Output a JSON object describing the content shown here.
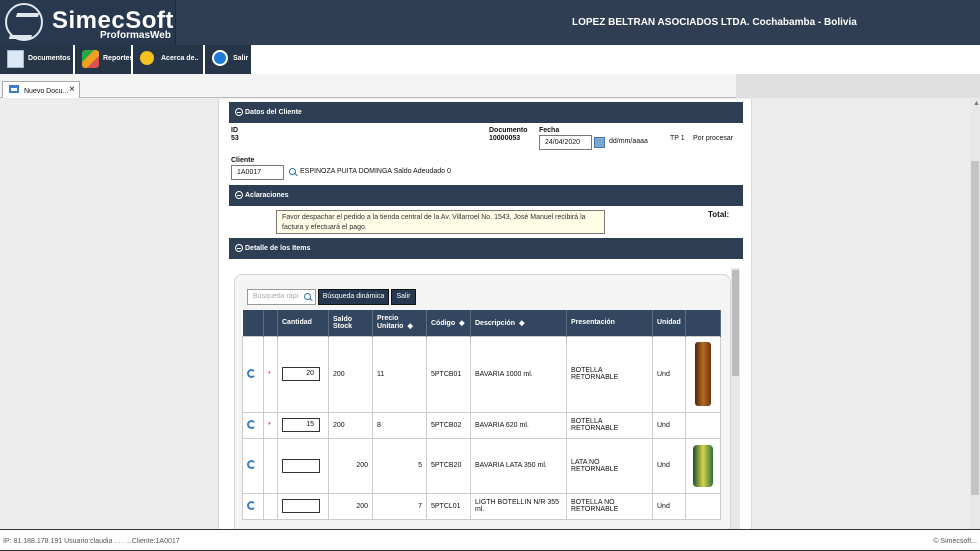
{
  "header": {
    "brand": "SimecSoft",
    "app": "ProformasWeb",
    "company": "LOPEZ BELTRAN ASOCIADOS LTDA. Cochabamba - Bolivia"
  },
  "menu": [
    {
      "label": "Documentos",
      "icon": "document-add-icon"
    },
    {
      "label": "Reportes",
      "icon": "reports-icon"
    },
    {
      "label": "Acerca de..",
      "icon": "award-icon"
    },
    {
      "label": "Salir",
      "icon": "exit-arrow-icon"
    }
  ],
  "tab": {
    "label": "Nuevo Docu...",
    "close": "×"
  },
  "client_section": {
    "title": "Datos del Cliente",
    "id_label": "ID",
    "id_value": "53",
    "document_label": "Documento",
    "document_value": "10000053",
    "date_label": "Fecha",
    "date_value": "24/04/2020",
    "date_format": "dd/mm/aaaa",
    "tp": "TP 1",
    "status": "Por procesar",
    "client_label": "Cliente",
    "client_code": "1A0017",
    "client_name": "ESPINOZA PUITA DOMINGA Saldo Adeudado 0"
  },
  "notes_section": {
    "title": "Aclaraciones",
    "text": "Favor despachar el pedido a la tienda central de la Av. Villarroel No. 1543, José Manuel recibirá la factura y efectuará el pago.",
    "total_label": "Total:"
  },
  "detail_section": {
    "title": "Detalle de los Items",
    "search_placeholder": "Búsqueda rápi",
    "dynamic_search": "Búsqueda dinámica",
    "exit": "Salir"
  },
  "table": {
    "headers": [
      "Cantidad",
      "Saldo Stock",
      "Precio Unitario",
      "Código",
      "Descripción",
      "Presentación",
      "Unidad"
    ],
    "rows": [
      {
        "marker": "*",
        "quantity": "20",
        "stock": "200",
        "price": "11",
        "code": "5PTCB01",
        "description": "BAVARIA 1000 ml.",
        "presentation": "BOTELLA RETORNABLE",
        "unit": "Und",
        "image": "bottle"
      },
      {
        "marker": "*",
        "quantity": "15",
        "stock": "200",
        "price": "8",
        "code": "5PTCB02",
        "description": "BAVARIA 620 ml.",
        "presentation": "BOTELLA RETORNABLE",
        "unit": "Und",
        "image": ""
      },
      {
        "marker": "",
        "quantity": "",
        "stock": "200",
        "price": "5",
        "code": "5PTCB20",
        "description": "BAVARIA LATA 350 ml.",
        "presentation": "LATA NO RETORNABLE",
        "unit": "Und",
        "image": "can"
      },
      {
        "marker": "",
        "quantity": "",
        "stock": "200",
        "price": "7",
        "code": "5PTCL01",
        "description": "LIGTH BOTELLIN N/R 355 ml.",
        "presentation": "BOTELLA NO RETORNABLE",
        "unit": "Und",
        "image": ""
      }
    ]
  },
  "status": {
    "left": "IP: 81.188.178.191 Usuario:claudia . . . ...Cliente:1A0017",
    "right": "© Simecsoft..."
  }
}
